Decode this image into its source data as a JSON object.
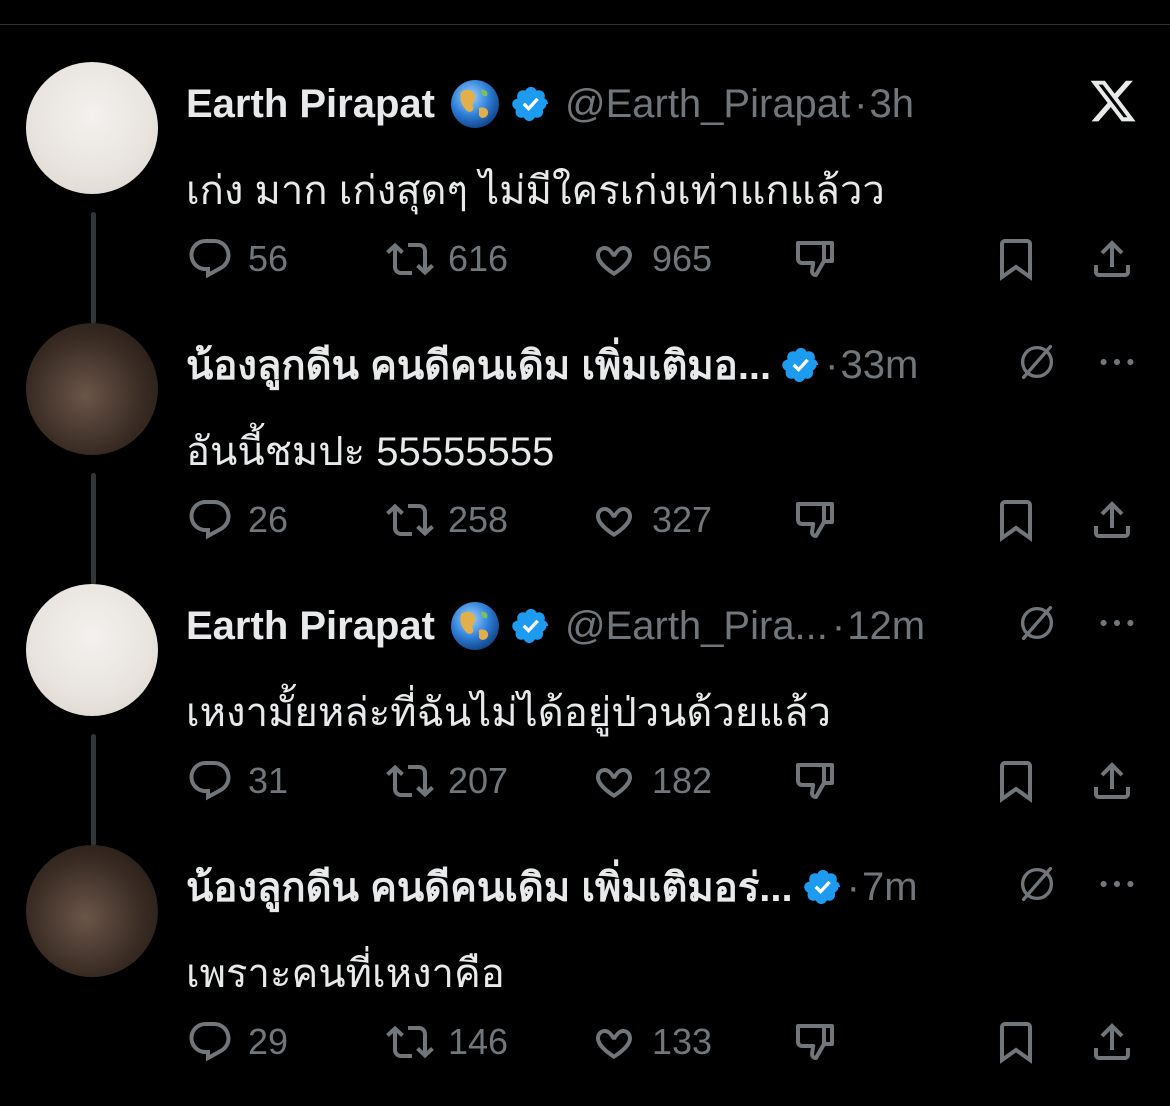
{
  "tweets": [
    {
      "name": "Earth Pirapat",
      "has_globe": true,
      "handle": "@Earth_Pirapat",
      "dot": "·",
      "time": "3h",
      "text": "เก่ง มาก เก่งสุดๆ ไม่มีใครเก่งเท่าแกแล้วว",
      "replies": "56",
      "retweets": "616",
      "likes": "965",
      "avatar": "light",
      "corner": "x-logo"
    },
    {
      "name": "น้องลูกดีน คนดีคนเดิม เพิ่มเติมอ...",
      "has_globe": false,
      "handle": "",
      "dot": "·",
      "time": "33m",
      "text": "อันนี้ชมปะ 55555555",
      "replies": "26",
      "retweets": "258",
      "likes": "327",
      "avatar": "dark",
      "corner": "mute"
    },
    {
      "name": "Earth Pirapat",
      "has_globe": true,
      "handle": "@Earth_Pira...",
      "dot": "·",
      "time": "12m",
      "text": "เหงามั้ยหล่ะที่ฉันไม่ได้อยู่ป่วนด้วยแล้ว",
      "replies": "31",
      "retweets": "207",
      "likes": "182",
      "avatar": "light",
      "corner": "mute"
    },
    {
      "name": "น้องลูกดีน คนดีคนเดิม เพิ่มเติมอร่...",
      "has_globe": false,
      "handle": "",
      "dot": "·",
      "time": "7m",
      "text": "เพราะคนที่เหงาคือ",
      "replies": "29",
      "retweets": "146",
      "likes": "133",
      "avatar": "dark",
      "corner": "mute"
    }
  ],
  "colors": {
    "background": "#000000",
    "primary_text": "#e7e9ea",
    "secondary_text": "#71767b",
    "verified_blue": "#1d9bf0",
    "thread_line": "#333639"
  },
  "icons": [
    "reply-icon",
    "retweet-icon",
    "like-icon",
    "dislike-icon",
    "bookmark-icon",
    "share-icon",
    "verified-badge-icon",
    "globe-emoji-icon",
    "x-logo-icon",
    "mute-icon",
    "more-icon"
  ]
}
